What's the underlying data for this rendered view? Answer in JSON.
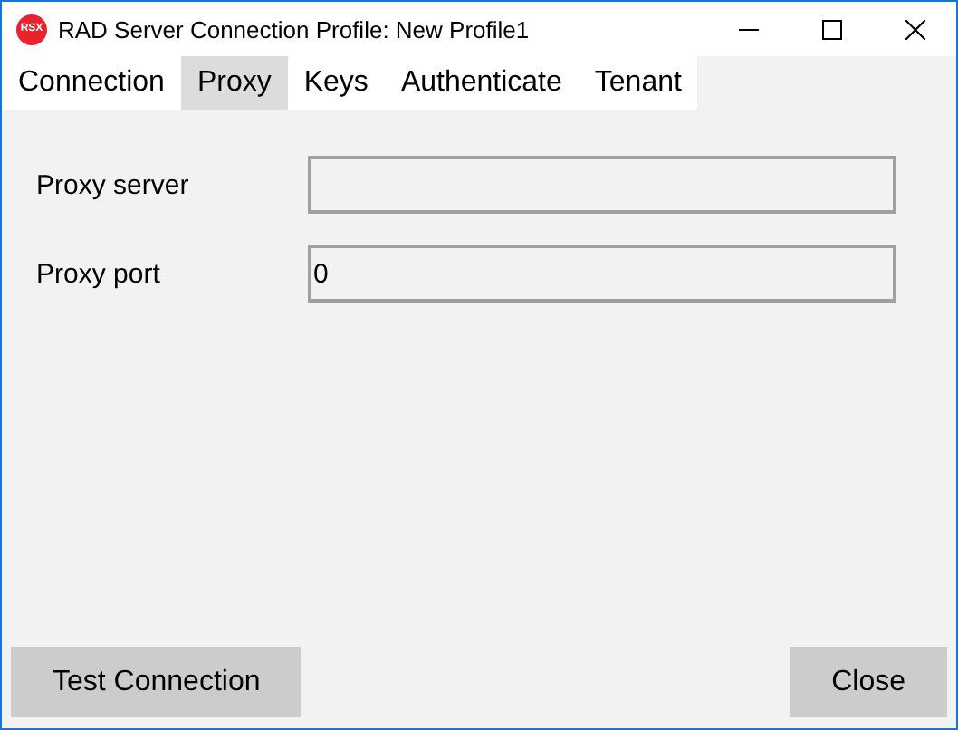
{
  "window": {
    "title": "RAD Server Connection Profile: New Profile1",
    "app_icon_text": "RSX"
  },
  "tabs": [
    {
      "label": "Connection",
      "selected": false
    },
    {
      "label": "Proxy",
      "selected": true
    },
    {
      "label": "Keys",
      "selected": false
    },
    {
      "label": "Authenticate",
      "selected": false
    },
    {
      "label": "Tenant",
      "selected": false
    }
  ],
  "fields": [
    {
      "label": "Proxy server"
    },
    {
      "label": "Proxy port",
      "value": "0"
    }
  ],
  "buttons": [
    {
      "label": "Test Connection"
    },
    {
      "label": "Close"
    }
  ]
}
